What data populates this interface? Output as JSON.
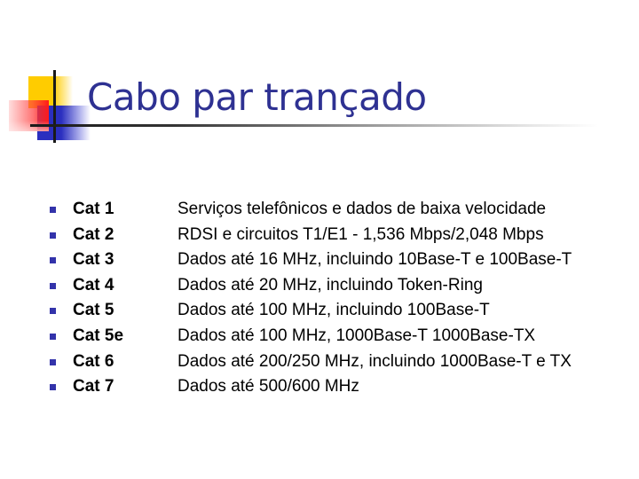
{
  "slide": {
    "title": "Cabo par trançado",
    "colors": {
      "title": "#2e3192",
      "bullet": "#3333aa",
      "logo_yellow": "#ffcc00",
      "logo_red": "#ff1a1a",
      "logo_blue": "#2b2fbf",
      "logo_lines": "#1a1a1a"
    },
    "bullet_icon": "square-bullet-icon",
    "rows": [
      {
        "category": "Cat 1",
        "description": "Serviços telefônicos e dados de baixa velocidade"
      },
      {
        "category": "Cat 2",
        "description": "RDSI e circuitos T1/E1 - 1,536 Mbps/2,048 Mbps"
      },
      {
        "category": "Cat 3",
        "description": "Dados até 16 MHz, incluindo 10Base-T e 100Base-T"
      },
      {
        "category": "Cat 4",
        "description": "Dados até 20 MHz, incluindo Token-Ring"
      },
      {
        "category": "Cat 5",
        "description": "Dados até 100 MHz, incluindo 100Base-T"
      },
      {
        "category": "Cat 5e",
        "description": "Dados até 100 MHz, 1000Base-T 1000Base-TX"
      },
      {
        "category": "Cat 6",
        "description": "Dados até 200/250 MHz, incluindo 1000Base-T e TX"
      },
      {
        "category": "Cat 7",
        "description": "Dados até 500/600 MHz"
      }
    ]
  }
}
